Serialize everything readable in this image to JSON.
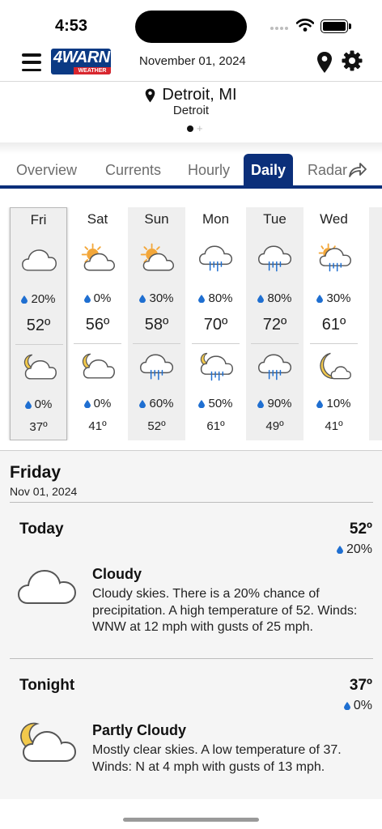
{
  "status_bar": {
    "time": "4:53"
  },
  "header": {
    "date": "November 01, 2024",
    "logo_main": "4WARN",
    "logo_sub": "WEATHER"
  },
  "location": {
    "city": "Detroit, MI",
    "subtitle": "Detroit"
  },
  "tabs": [
    {
      "label": "Overview",
      "active": false
    },
    {
      "label": "Currents",
      "active": false
    },
    {
      "label": "Hourly",
      "active": false
    },
    {
      "label": "Daily",
      "active": true
    },
    {
      "label": "Radar",
      "active": false
    }
  ],
  "days": [
    {
      "name": "Fri",
      "day_icon": "cloudy-icon",
      "day_precip": "20%",
      "high": "52º",
      "night_icon": "partly-cloudy-night-icon",
      "night_precip": "0%",
      "low": "37º"
    },
    {
      "name": "Sat",
      "day_icon": "partly-sunny-icon",
      "day_precip": "0%",
      "high": "56º",
      "night_icon": "partly-cloudy-night-icon",
      "night_precip": "0%",
      "low": "41º"
    },
    {
      "name": "Sun",
      "day_icon": "partly-sunny-icon",
      "day_precip": "30%",
      "high": "58º",
      "night_icon": "rain-icon",
      "night_precip": "60%",
      "low": "52º"
    },
    {
      "name": "Mon",
      "day_icon": "rain-icon",
      "day_precip": "80%",
      "high": "70º",
      "night_icon": "night-rain-icon",
      "night_precip": "50%",
      "low": "61º"
    },
    {
      "name": "Tue",
      "day_icon": "rain-icon",
      "day_precip": "80%",
      "high": "72º",
      "night_icon": "rain-icon",
      "night_precip": "90%",
      "low": "49º"
    },
    {
      "name": "Wed",
      "day_icon": "sun-rain-icon",
      "day_precip": "30%",
      "high": "61º",
      "night_icon": "moon-cloud-icon",
      "night_precip": "10%",
      "low": "41º"
    }
  ],
  "detail": {
    "day_title": "Friday",
    "date": "Nov 01, 2024",
    "today": {
      "label": "Today",
      "temp": "52º",
      "precip": "20%",
      "condition": "Cloudy",
      "text": "Cloudy skies. There is a 20% chance of precipitation. A high temperature of 52. Winds: WNW at 12 mph with gusts of 25 mph."
    },
    "tonight": {
      "label": "Tonight",
      "temp": "37º",
      "precip": "0%",
      "condition": "Partly Cloudy",
      "text": "Mostly clear skies. A low temperature of 37. Winds: N at 4 mph with gusts of 13 mph."
    }
  },
  "colors": {
    "brand_navy": "#0b2f7a",
    "logo_red": "#d8262e",
    "drop_blue": "#1f6fd1",
    "sun_orange": "#f3a73a",
    "moon_yellow": "#f2c94c"
  }
}
